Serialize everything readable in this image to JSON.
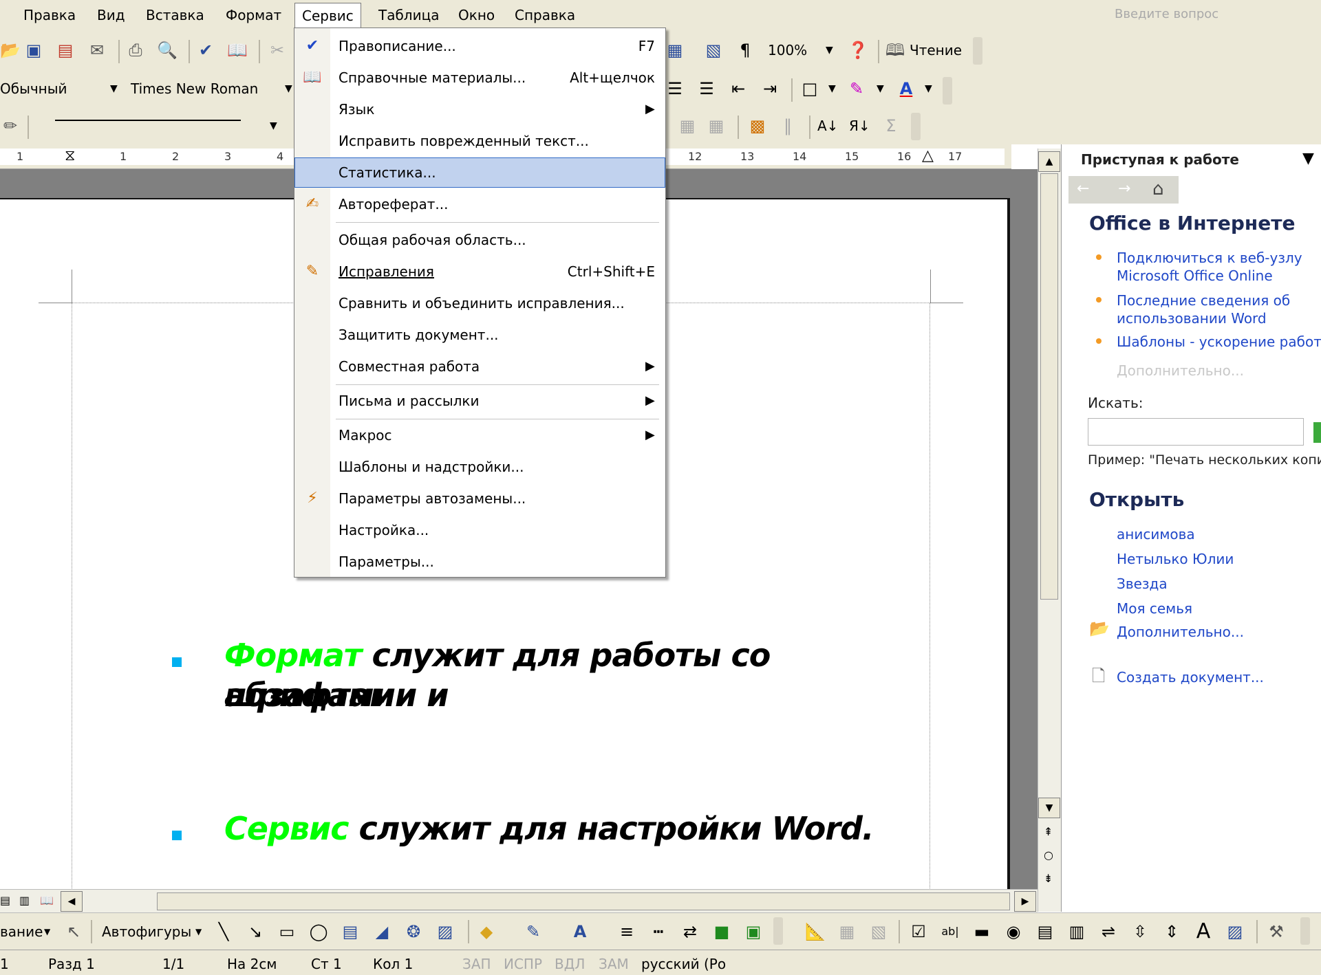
{
  "menubar": {
    "items": [
      "Правка",
      "Вид",
      "Вставка",
      "Формат",
      "Сервис",
      "Таблица",
      "Окно",
      "Справка"
    ],
    "question_placeholder": "Введите вопрос"
  },
  "toolbar": {
    "zoom": "100%",
    "reading": "Чтение",
    "style": "Обычный",
    "font": "Times New Roman"
  },
  "ruler": {
    "numbers": [
      "1",
      "1",
      "2",
      "3",
      "4",
      "12",
      "13",
      "14",
      "15",
      "16",
      "17"
    ]
  },
  "menu": {
    "items": [
      {
        "label": "Правописание...",
        "shortcut": "F7",
        "icon": "spelling-icon"
      },
      {
        "label": "Справочные материалы...",
        "shortcut": "Alt+щелчок",
        "icon": "research-icon"
      },
      {
        "label": "Язык",
        "submenu": true
      },
      {
        "label": "Исправить поврежденный текст..."
      },
      {
        "label": "Статистика...",
        "selected": true
      },
      {
        "label": "Автореферат...",
        "icon": "autosummary-icon"
      },
      {
        "label": "Общая рабочая область..."
      },
      {
        "label": "Исправления",
        "shortcut": "Ctrl+Shift+E",
        "icon": "track-changes-icon"
      },
      {
        "label": "Сравнить и объединить исправления..."
      },
      {
        "label": "Защитить документ..."
      },
      {
        "label": "Совместная работа",
        "submenu": true
      },
      {
        "label": "Письма и рассылки",
        "submenu": true
      },
      {
        "label": "Макрос",
        "submenu": true
      },
      {
        "label": "Шаблоны и надстройки..."
      },
      {
        "label": "Параметры автозамены...",
        "icon": "autocorrect-icon"
      },
      {
        "label": "Настройка..."
      },
      {
        "label": "Параметры..."
      }
    ]
  },
  "document": {
    "line1_highlight": "Формат",
    "line1_rest": " служит для работы со шрифтами и",
    "line1_cont": "абзацами.",
    "line2_highlight": "Сервис",
    "line2_rest": " служит для настройки Word.",
    "highlight_color": "#00ff00",
    "bullet_color": "#00b0f0"
  },
  "taskpane": {
    "title": "Приступая к работе",
    "section1": "Office в Интернете",
    "links": [
      "Подключиться к веб-узлу Microsoft Office Online",
      "Последние сведения об использовании Word",
      "Шаблоны - ускорение работы"
    ],
    "more1": "Дополнительно...",
    "search_label": "Искать:",
    "example": "Пример: \"Печать нескольких копий\"",
    "section2": "Открыть",
    "recent": [
      "анисимова",
      "Нетылько Юлии",
      "Звезда",
      "Моя семья"
    ],
    "more2": "Дополнительно...",
    "create": "Создать документ..."
  },
  "drawbar": {
    "drawing": "вание",
    "autoshapes": "Автофигуры"
  },
  "statusbar": {
    "page": "1",
    "section": "Разд 1",
    "pages": "1/1",
    "at": "На 2см",
    "line": "Ст 1",
    "col": "Кол 1",
    "rec": "ЗАП",
    "trk": "ИСПР",
    "ext": "ВДЛ",
    "ovr": "ЗАМ",
    "lang": "русский (Ро"
  },
  "colors": {
    "chrome": "#ece9d8",
    "link": "#2048c8",
    "selection": "#c1d2ee"
  }
}
